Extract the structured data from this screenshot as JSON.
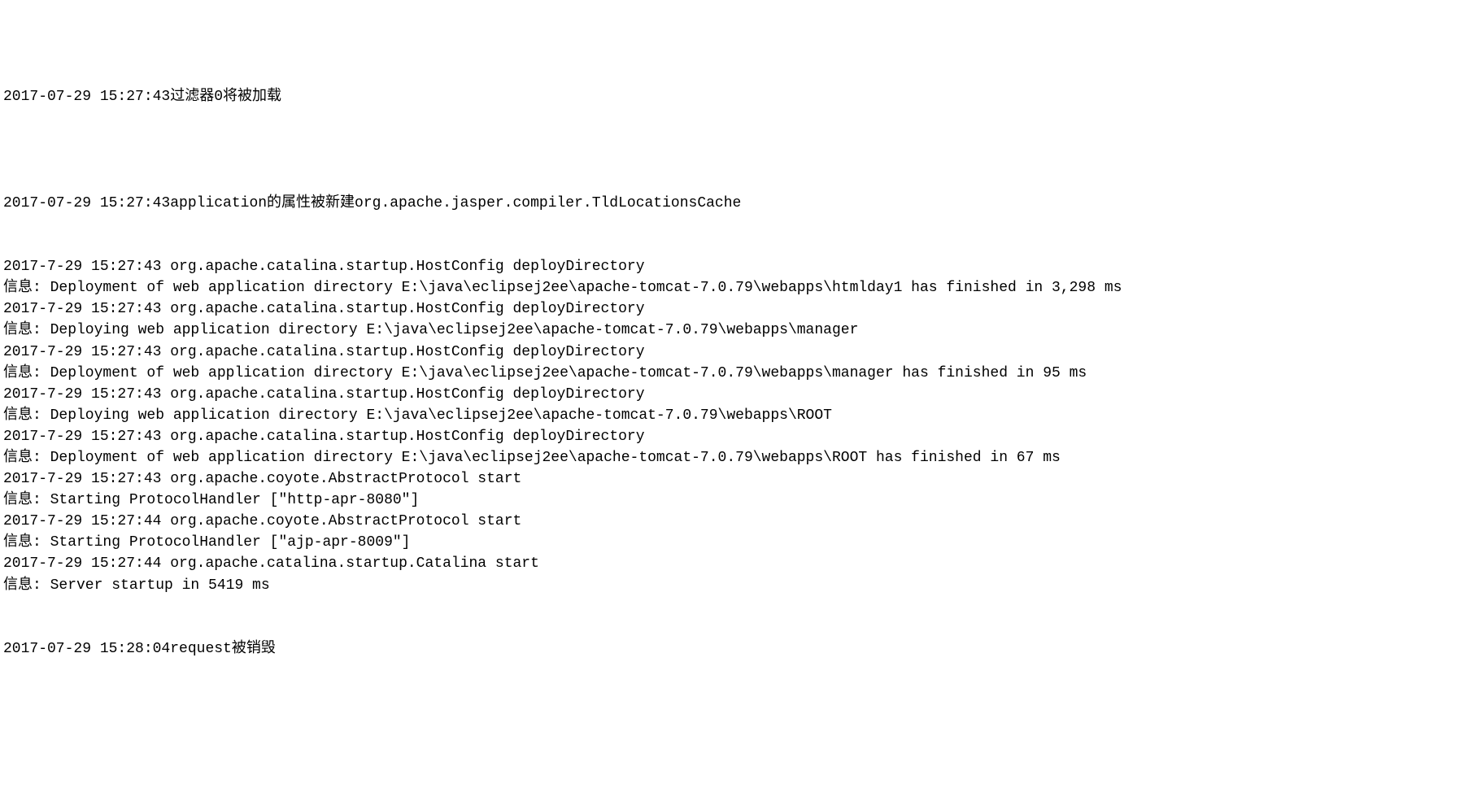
{
  "log_lines": [
    "2017-07-29 15:27:43过滤器0将被加载",
    "",
    "",
    "",
    "",
    "2017-07-29 15:27:43application的属性被新建org.apache.jasper.compiler.TldLocationsCache",
    "",
    "",
    "2017-7-29 15:27:43 org.apache.catalina.startup.HostConfig deployDirectory",
    "信息: Deployment of web application directory E:\\java\\eclipsej2ee\\apache-tomcat-7.0.79\\webapps\\htmlday1 has finished in 3,298 ms",
    "2017-7-29 15:27:43 org.apache.catalina.startup.HostConfig deployDirectory",
    "信息: Deploying web application directory E:\\java\\eclipsej2ee\\apache-tomcat-7.0.79\\webapps\\manager",
    "2017-7-29 15:27:43 org.apache.catalina.startup.HostConfig deployDirectory",
    "信息: Deployment of web application directory E:\\java\\eclipsej2ee\\apache-tomcat-7.0.79\\webapps\\manager has finished in 95 ms",
    "2017-7-29 15:27:43 org.apache.catalina.startup.HostConfig deployDirectory",
    "信息: Deploying web application directory E:\\java\\eclipsej2ee\\apache-tomcat-7.0.79\\webapps\\ROOT",
    "2017-7-29 15:27:43 org.apache.catalina.startup.HostConfig deployDirectory",
    "信息: Deployment of web application directory E:\\java\\eclipsej2ee\\apache-tomcat-7.0.79\\webapps\\ROOT has finished in 67 ms",
    "2017-7-29 15:27:43 org.apache.coyote.AbstractProtocol start",
    "信息: Starting ProtocolHandler [\"http-apr-8080\"]",
    "2017-7-29 15:27:44 org.apache.coyote.AbstractProtocol start",
    "信息: Starting ProtocolHandler [\"ajp-apr-8009\"]",
    "2017-7-29 15:27:44 org.apache.catalina.startup.Catalina start",
    "信息: Server startup in 5419 ms",
    "",
    "",
    "2017-07-29 15:28:04request被销毁"
  ],
  "watermark": ""
}
